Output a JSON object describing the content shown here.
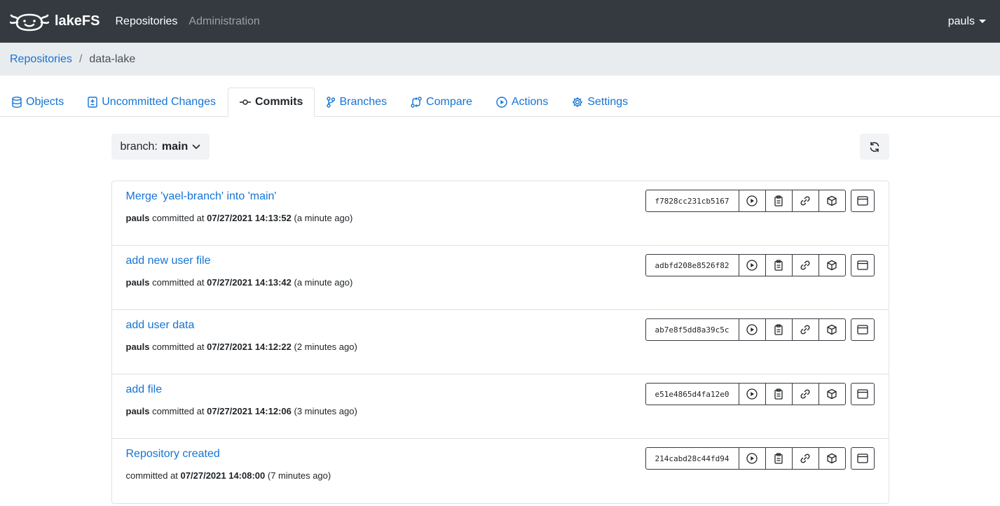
{
  "navbar": {
    "brand": "lakeFS",
    "links": {
      "repositories": "Repositories",
      "administration": "Administration"
    },
    "user": "pauls"
  },
  "breadcrumb": {
    "root": "Repositories",
    "separator": "/",
    "current": "data-lake"
  },
  "tabs": {
    "objects": "Objects",
    "uncommitted": "Uncommitted Changes",
    "commits": "Commits",
    "branches": "Branches",
    "compare": "Compare",
    "actions": "Actions",
    "settings": "Settings"
  },
  "toolbar": {
    "branch_prefix": "branch:",
    "branch_name": "main"
  },
  "meta_text": {
    "committed_at": "committed at"
  },
  "commits": [
    {
      "message": "Merge 'yael-branch' into 'main'",
      "author": "pauls",
      "timestamp": "07/27/2021 14:13:52",
      "relative": "(a minute ago)",
      "sha": "f7828cc231cb5167"
    },
    {
      "message": "add new user file",
      "author": "pauls",
      "timestamp": "07/27/2021 14:13:42",
      "relative": "(a minute ago)",
      "sha": "adbfd208e8526f82"
    },
    {
      "message": "add user data",
      "author": "pauls",
      "timestamp": "07/27/2021 14:12:22",
      "relative": "(2 minutes ago)",
      "sha": "ab7e8f5dd8a39c5c"
    },
    {
      "message": "add file",
      "author": "pauls",
      "timestamp": "07/27/2021 14:12:06",
      "relative": "(3 minutes ago)",
      "sha": "e51e4865d4fa12e0"
    },
    {
      "message": "Repository created",
      "author": "",
      "timestamp": "07/27/2021 14:08:00",
      "relative": "(7 minutes ago)",
      "sha": "214cabd28c44fd94"
    }
  ],
  "colors": {
    "navbar": "#343a40",
    "link": "#1474d4",
    "breadcrumb_bg": "#e9ecef"
  },
  "icons": {
    "commit_actions": [
      "play-circle-icon",
      "clipboard-icon",
      "link-icon",
      "package-icon"
    ],
    "browse": "browser-icon"
  }
}
